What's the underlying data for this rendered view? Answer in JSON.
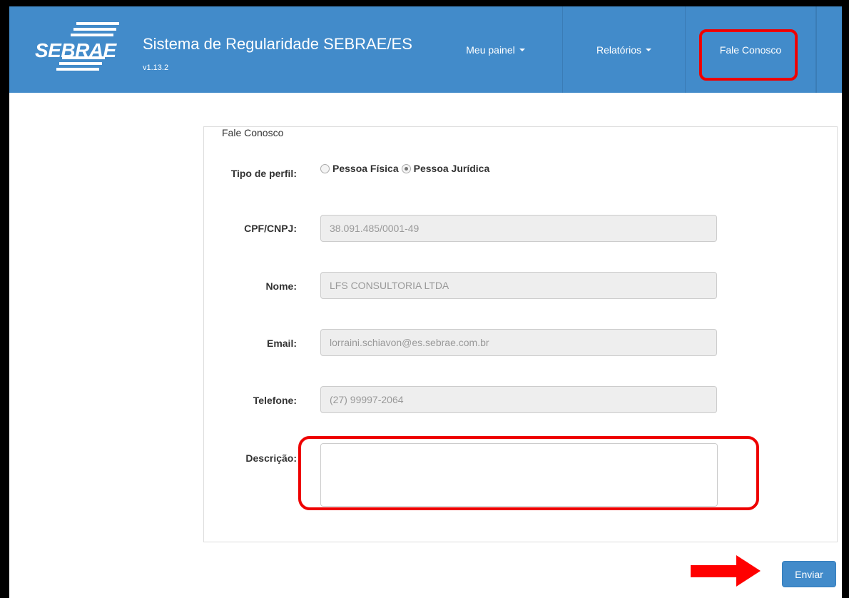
{
  "brand": {
    "logo_text": "SEBRAE",
    "title": "Sistema de Regularidade SEBRAE/ES",
    "version": "v1.13.2"
  },
  "nav": {
    "meu_painel": "Meu painel",
    "relatorios": "Relatórios",
    "fale_conosco": "Fale Conosco"
  },
  "form": {
    "legend": "Fale Conosco",
    "tipo_label": "Tipo de perfil:",
    "radio_fisica": "Pessoa Física",
    "radio_juridica": "Pessoa Jurídica",
    "selected_profile": "Pessoa Jurídica",
    "cpf_label": "CPF/CNPJ:",
    "cpf_value": "38.091.485/0001-49",
    "nome_label": "Nome:",
    "nome_value": "LFS CONSULTORIA LTDA",
    "email_label": "Email:",
    "email_value": "lorraini.schiavon@es.sebrae.com.br",
    "telefone_label": "Telefone:",
    "telefone_value": "(27) 99997-2064",
    "descricao_label": "Descrição:",
    "descricao_value": "",
    "submit_label": "Enviar"
  },
  "colors": {
    "navbar": "#428bca",
    "highlight": "#ee0000",
    "arrow": "#ff0000"
  }
}
